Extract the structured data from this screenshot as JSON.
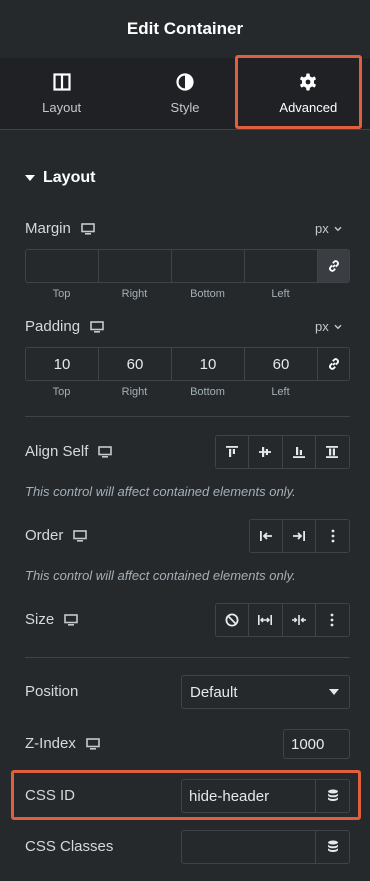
{
  "header": {
    "title": "Edit Container"
  },
  "tabs": [
    {
      "label": "Layout",
      "icon": "columns-icon"
    },
    {
      "label": "Style",
      "icon": "half-circle-icon"
    },
    {
      "label": "Advanced",
      "icon": "gear-icon",
      "active": true
    }
  ],
  "section": {
    "title": "Layout"
  },
  "margin": {
    "label": "Margin",
    "unit": "px",
    "values": [
      "",
      "",
      "",
      ""
    ],
    "sides": [
      "Top",
      "Right",
      "Bottom",
      "Left"
    ]
  },
  "padding": {
    "label": "Padding",
    "unit": "px",
    "values": [
      "10",
      "60",
      "10",
      "60"
    ],
    "sides": [
      "Top",
      "Right",
      "Bottom",
      "Left"
    ]
  },
  "align_self": {
    "label": "Align Self",
    "note": "This control will affect contained elements only."
  },
  "order": {
    "label": "Order",
    "note": "This control will affect contained elements only."
  },
  "size": {
    "label": "Size"
  },
  "position": {
    "label": "Position",
    "value": "Default"
  },
  "z_index": {
    "label": "Z-Index",
    "value": "1000"
  },
  "css_id": {
    "label": "CSS ID",
    "value": "hide-header"
  },
  "css_classes": {
    "label": "CSS Classes",
    "value": ""
  },
  "colors": {
    "background": "#26292c",
    "tabbar": "#1f2124",
    "highlight": "#e0603e",
    "border": "#3f444b"
  }
}
